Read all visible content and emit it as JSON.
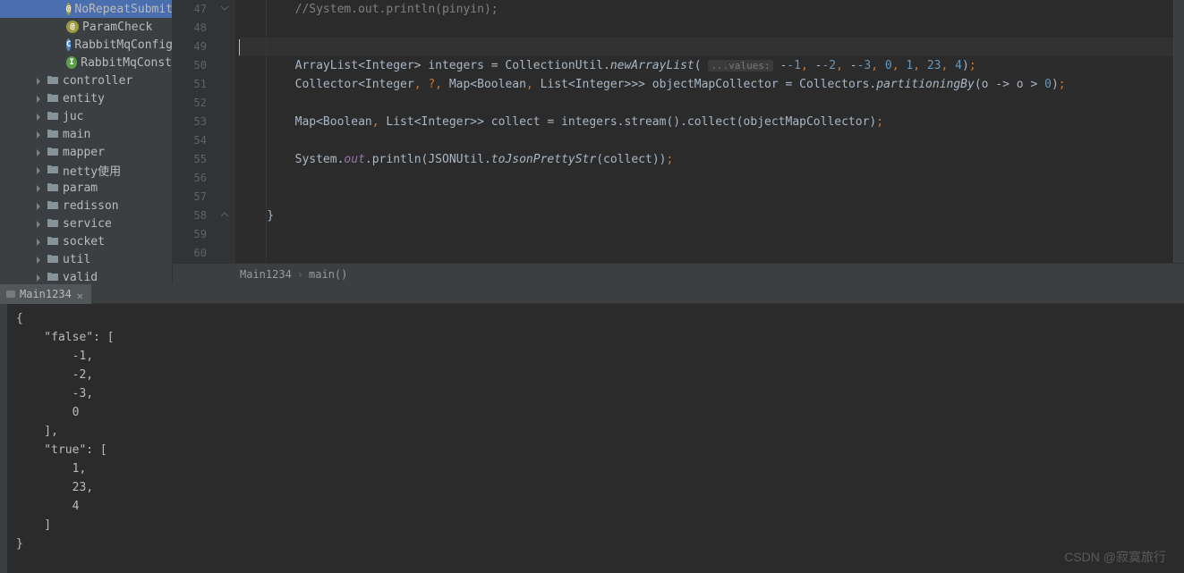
{
  "sidebar": {
    "items": [
      {
        "label": "NoRepeatSubmit",
        "iconType": "annotation",
        "iconLetter": "@"
      },
      {
        "label": "ParamCheck",
        "iconType": "annotation",
        "iconLetter": "@"
      },
      {
        "label": "RabbitMqConfig",
        "iconType": "class",
        "iconLetter": "C"
      },
      {
        "label": "RabbitMqConst",
        "iconType": "interface",
        "iconLetter": "I"
      }
    ],
    "folders": [
      {
        "label": "controller"
      },
      {
        "label": "entity"
      },
      {
        "label": "juc"
      },
      {
        "label": "main"
      },
      {
        "label": "mapper"
      },
      {
        "label": "netty使用"
      },
      {
        "label": "param"
      },
      {
        "label": "redisson"
      },
      {
        "label": "service"
      },
      {
        "label": "socket"
      },
      {
        "label": "util"
      },
      {
        "label": "valid"
      }
    ]
  },
  "editor": {
    "lineNumbers": [
      "47",
      "48",
      "49",
      "50",
      "51",
      "52",
      "53",
      "54",
      "55",
      "56",
      "57",
      "58",
      "59",
      "60"
    ],
    "lines": {
      "l47_comment": "//System.out.println(pinyin);",
      "l50_paramHint": "...values:",
      "l50_text1": "ArrayList<Integer> integers = CollectionUtil.",
      "l50_method": "newArrayList",
      "l50_nums": [
        "-1",
        "-2",
        "-3",
        "0",
        "1",
        "23",
        "4"
      ],
      "l51_text1": "Collector<Integer",
      "l51_q": "?",
      "l51_text2": "Map<Boolean",
      "l51_text3": "List<Integer>>> objectMapCollector = Collectors.",
      "l51_method": "partitioningBy",
      "l51_lambda": "(o -> o > ",
      "l51_zero": "0",
      "l53_text": "Map<Boolean",
      "l53_text2": "List<Integer>> collect = integers.stream().collect(objectMapCollector)",
      "l55_text1": "System.",
      "l55_out": "out",
      "l55_text2": ".println(JSONUtil.",
      "l55_method": "toJsonPrettyStr",
      "l55_text3": "(collect))"
    }
  },
  "breadcrumb": {
    "item1": "Main1234",
    "item2": "main()"
  },
  "console": {
    "tabLabel": "Main1234",
    "output": "{\n    \"false\": [\n        -1,\n        -2,\n        -3,\n        0\n    ],\n    \"true\": [\n        1,\n        23,\n        4\n    ]\n}"
  },
  "watermark": "CSDN @寂寞旅行"
}
